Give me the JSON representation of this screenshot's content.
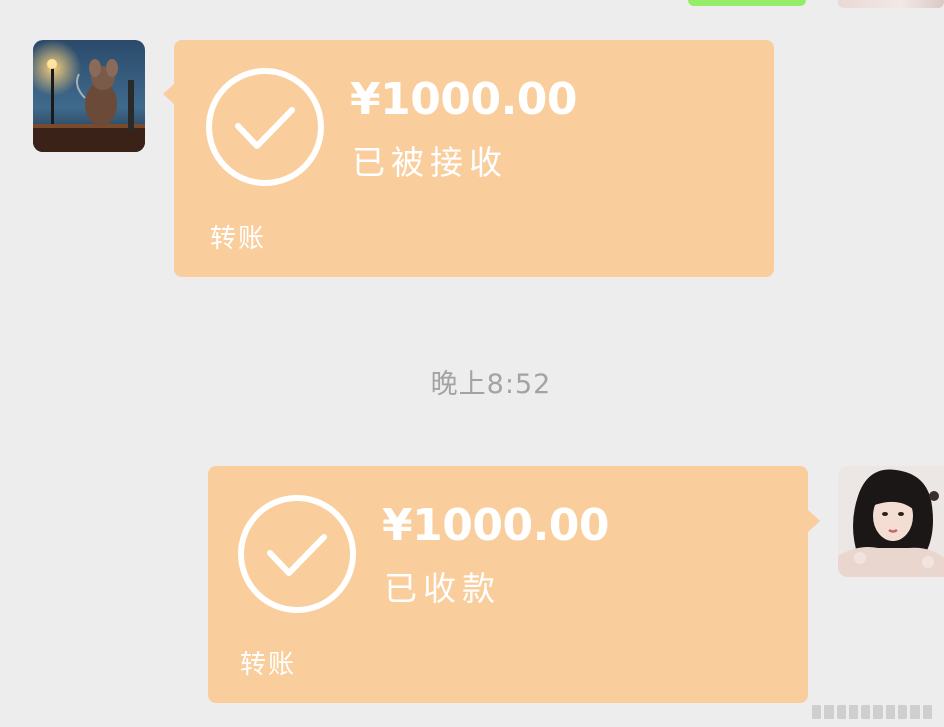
{
  "chat": {
    "messages": [
      {
        "direction": "incoming",
        "amount": "¥1000.00",
        "status": "已被接收",
        "label": "转账"
      },
      {
        "direction": "outgoing",
        "amount": "¥1000.00",
        "status": "已收款",
        "label": "转账"
      }
    ],
    "timestamp": "晚上8:52"
  },
  "colors": {
    "background": "#ededed",
    "transfer_bubble": "#f9ce9c",
    "sent_message_bubble": "#95ec69",
    "timestamp_text": "#a3a3a3",
    "bubble_text": "#ffffff"
  },
  "icons": {
    "check": "check-circle-icon"
  }
}
